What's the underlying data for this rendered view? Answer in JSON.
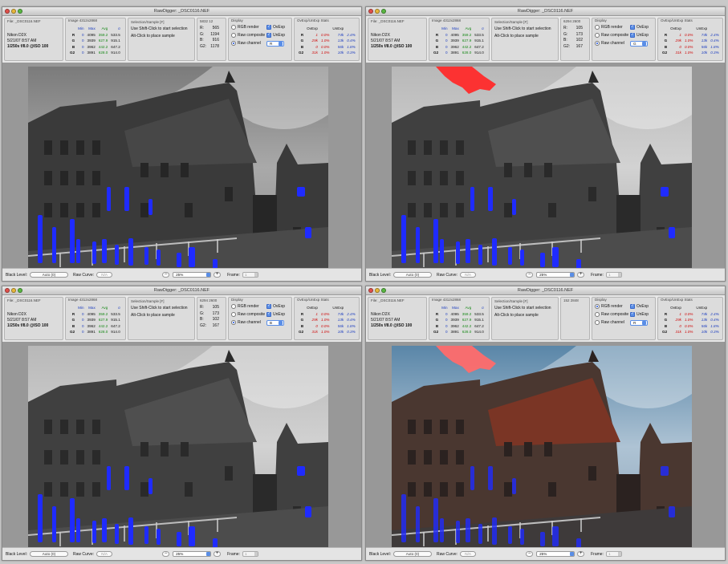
{
  "windows": [
    {
      "title": "RawDigger: _DSC0116.NEF",
      "sample_title": "5832 12",
      "sample": [
        [
          "R:",
          "565"
        ],
        [
          "G:",
          "1194"
        ],
        [
          "B:",
          "916"
        ],
        [
          "G2:",
          "1178"
        ]
      ],
      "render_mode": "raw_channel",
      "channel": "R",
      "photo_style": "raw-overexp"
    },
    {
      "title": "RawDigger: _DSC0116.NEF",
      "sample_title": "6294 2600",
      "sample": [
        [
          "R:",
          "105"
        ],
        [
          "G:",
          "173"
        ],
        [
          "B:",
          "102"
        ],
        [
          "G2:",
          "167"
        ]
      ],
      "render_mode": "raw_channel",
      "channel": "G",
      "photo_style": "raw-red"
    },
    {
      "title": "RawDigger: _DSC0116.NEF",
      "sample_title": "6294 2600",
      "sample": [
        [
          "R:",
          "105"
        ],
        [
          "G:",
          "173"
        ],
        [
          "B:",
          "102"
        ],
        [
          "G2:",
          "167"
        ]
      ],
      "render_mode": "raw_channel",
      "channel": "B",
      "photo_style": "raw-blue"
    },
    {
      "title": "RawDigger: _DSC0116.NEF",
      "sample_title": "152 2848",
      "sample": [],
      "render_mode": "rgb_render",
      "channel": "R",
      "photo_style": "rgb"
    }
  ],
  "common": {
    "file_panel_title": "File: _DSC0116.NEF",
    "camera": "Nikon D2X",
    "datetime": "5/21/07 8:57 AM",
    "exposure": "1/250s f/8.0 @ISO 100",
    "image_panel_title": "Image 4312x2868",
    "stats_headers": [
      "",
      "Min",
      "Max",
      "Avg",
      "σ"
    ],
    "stats_rows": [
      [
        "R",
        "0",
        "4095",
        "359.2",
        "533.5"
      ],
      [
        "G",
        "0",
        "3939",
        "627.9",
        "915.1"
      ],
      [
        "B",
        "0",
        "3962",
        "442.2",
        "647.2"
      ],
      [
        "G2",
        "0",
        "3891",
        "628.0",
        "914.0"
      ]
    ],
    "selection_panel_title": "Selection/Sample [F]",
    "selection_hint_1": "Use Shift-Click to start selection",
    "selection_hint_2": "Alt-Click to place sample",
    "display_panel_title": "Display",
    "rgb_render_label": "RGB render",
    "raw_composite_label": "Raw composite",
    "raw_channel_label": "Raw channel",
    "ovexp_label": "OvExp",
    "unexp_label": "UnExp",
    "exp_panel_title": "OvExp/UnExp Stats",
    "exp_headers": [
      "",
      "OvExp",
      "",
      "UnExp",
      ""
    ],
    "exp_rows": [
      [
        "R",
        "1",
        "0.0%",
        "74k",
        "2.4%"
      ],
      [
        "G",
        "29k",
        "1.0%",
        "13k",
        "0.4%"
      ],
      [
        "B",
        "0",
        "0.0%",
        "56k",
        "1.8%"
      ],
      [
        "G2",
        "31k",
        "1.0%",
        "10k",
        "0.3%"
      ]
    ],
    "black_level_label": "Black Level:",
    "black_level_value": "Auto (0)",
    "raw_curve_label": "Raw Curve:",
    "raw_curve_value": "N/A",
    "zoom_minus": "−",
    "zoom_value": "25%",
    "zoom_plus": "+",
    "frame_label": "Frame:",
    "frame_value": "1"
  },
  "colors": {
    "overexposure": "#ff2a2a",
    "underexposure": "#1f2bff",
    "accent": "#5a8ee6"
  }
}
